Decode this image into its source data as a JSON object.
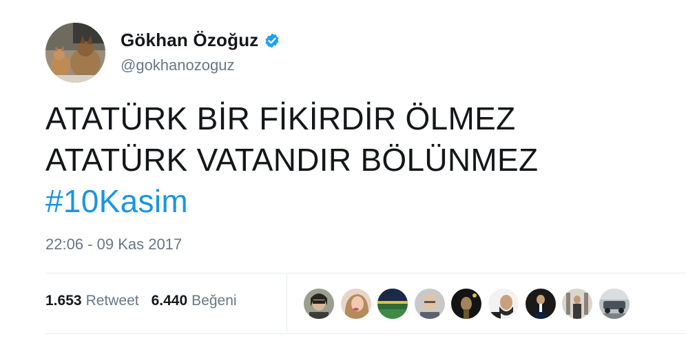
{
  "user": {
    "display_name": "Gökhan Özoğuz",
    "handle": "@gokhanozoguz",
    "verified": true,
    "avatar_icon": "dog-and-cat-avatar"
  },
  "tweet": {
    "lines": [
      "ATATÜRK BİR FİKİRDİR ÖLMEZ",
      "ATATÜRK VATANDIR BÖLÜNMEZ"
    ],
    "hashtag": "#10Kasim",
    "timestamp": "22:06 - 09 Kas 2017"
  },
  "stats": {
    "retweets_count": "1.653",
    "retweets_label": "Retweet",
    "likes_count": "6.440",
    "likes_label": "Beğeni"
  },
  "likers": [
    {
      "name": "liker-1"
    },
    {
      "name": "liker-2"
    },
    {
      "name": "liker-3"
    },
    {
      "name": "liker-4"
    },
    {
      "name": "liker-5"
    },
    {
      "name": "liker-6"
    },
    {
      "name": "liker-7"
    },
    {
      "name": "liker-8"
    },
    {
      "name": "liker-9"
    }
  ],
  "colors": {
    "hashtag": "#1b95e0",
    "secondary_text": "#657786",
    "verified": "#1da1f2"
  }
}
